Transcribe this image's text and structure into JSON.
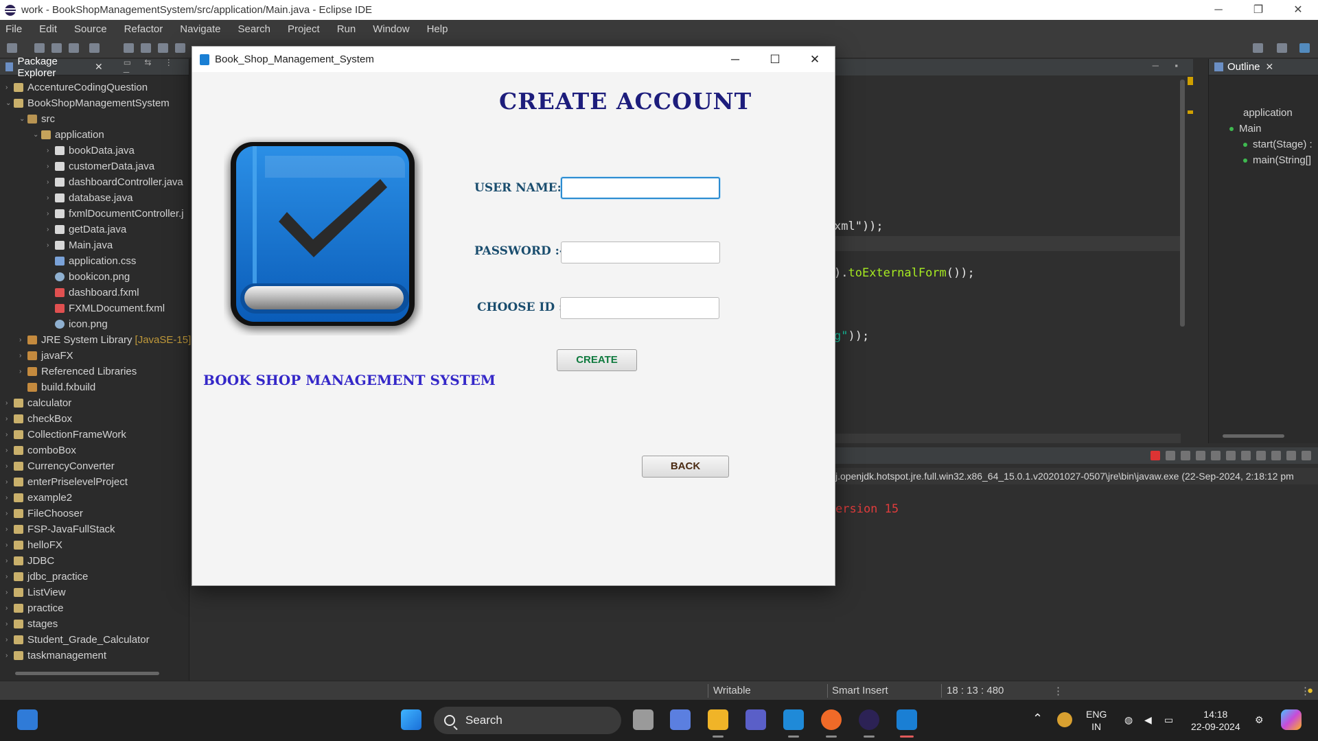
{
  "window": {
    "title": "work - BookShopManagementSystem/src/application/Main.java - Eclipse IDE",
    "controls": [
      "─",
      "❐",
      "✕"
    ]
  },
  "menu": [
    "File",
    "Edit",
    "Source",
    "Refactor",
    "Navigate",
    "Search",
    "Project",
    "Run",
    "Window",
    "Help"
  ],
  "package_explorer": {
    "tab_label": "Package Explorer",
    "close": "✕",
    "items": [
      {
        "label": "AccentureCodingQuestion",
        "icon": "project-icon",
        "chev": "›",
        "indent": 0
      },
      {
        "label": "BookShopManagementSystem",
        "icon": "project-icon",
        "chev": "⌄",
        "indent": 0
      },
      {
        "label": "src",
        "icon": "source-folder-icon",
        "chev": "⌄",
        "indent": 1
      },
      {
        "label": "application",
        "icon": "package-icon",
        "chev": "⌄",
        "indent": 2
      },
      {
        "label": "bookData.java",
        "icon": "java-file-icon",
        "chev": "›",
        "indent": 3
      },
      {
        "label": "customerData.java",
        "icon": "java-file-icon",
        "chev": "›",
        "indent": 3
      },
      {
        "label": "dashboardController.java",
        "icon": "java-file-icon",
        "chev": "›",
        "indent": 3
      },
      {
        "label": "database.java",
        "icon": "java-file-icon",
        "chev": "›",
        "indent": 3
      },
      {
        "label": "fxmlDocumentController.j",
        "icon": "java-file-icon",
        "chev": "›",
        "indent": 3
      },
      {
        "label": "getData.java",
        "icon": "java-file-icon",
        "chev": "›",
        "indent": 3
      },
      {
        "label": "Main.java",
        "icon": "java-file-icon",
        "chev": "›",
        "indent": 3
      },
      {
        "label": "application.css",
        "icon": "css-file-icon",
        "chev": "",
        "indent": 3
      },
      {
        "label": "bookicon.png",
        "icon": "image-file-icon",
        "chev": "",
        "indent": 3
      },
      {
        "label": "dashboard.fxml",
        "icon": "fxml-file-icon",
        "chev": "",
        "indent": 3
      },
      {
        "label": "FXMLDocument.fxml",
        "icon": "fxml-file-icon",
        "chev": "",
        "indent": 3
      },
      {
        "label": "icon.png",
        "icon": "image-file-icon",
        "chev": "",
        "indent": 3
      },
      {
        "label": "JRE System Library",
        "extra": "[JavaSE-15]",
        "icon": "library-icon",
        "chev": "›",
        "indent": 1
      },
      {
        "label": "javaFX",
        "icon": "library-icon",
        "chev": "›",
        "indent": 1
      },
      {
        "label": "Referenced Libraries",
        "icon": "library-icon",
        "chev": "›",
        "indent": 1
      },
      {
        "label": "build.fxbuild",
        "icon": "build-file-icon",
        "chev": "",
        "indent": 1
      },
      {
        "label": "calculator",
        "icon": "project-icon",
        "chev": "›",
        "indent": 0
      },
      {
        "label": "checkBox",
        "icon": "project-icon",
        "chev": "›",
        "indent": 0
      },
      {
        "label": "CollectionFrameWork",
        "icon": "project-icon",
        "chev": "›",
        "indent": 0
      },
      {
        "label": "comboBox",
        "icon": "project-icon",
        "chev": "›",
        "indent": 0
      },
      {
        "label": "CurrencyConverter",
        "icon": "project-icon",
        "chev": "›",
        "indent": 0
      },
      {
        "label": "enterPriselevelProject",
        "icon": "project-icon",
        "chev": "›",
        "indent": 0
      },
      {
        "label": "example2",
        "icon": "project-icon",
        "chev": "›",
        "indent": 0
      },
      {
        "label": "FileChooser",
        "icon": "project-icon",
        "chev": "›",
        "indent": 0
      },
      {
        "label": "FSP-JavaFullStack",
        "icon": "project-icon",
        "chev": "›",
        "indent": 0
      },
      {
        "label": "helloFX",
        "icon": "project-icon",
        "chev": "›",
        "indent": 0
      },
      {
        "label": "JDBC",
        "icon": "project-icon",
        "chev": "›",
        "indent": 0
      },
      {
        "label": "jdbc_practice",
        "icon": "project-icon",
        "chev": "›",
        "indent": 0
      },
      {
        "label": "ListView",
        "icon": "project-icon",
        "chev": "›",
        "indent": 0
      },
      {
        "label": "practice",
        "icon": "project-icon",
        "chev": "›",
        "indent": 0
      },
      {
        "label": "stages",
        "icon": "project-icon",
        "chev": "›",
        "indent": 0
      },
      {
        "label": "Student_Grade_Calculator",
        "icon": "project-icon",
        "chev": "›",
        "indent": 0
      },
      {
        "label": "taskmanagement",
        "icon": "project-icon",
        "chev": "›",
        "indent": 0
      }
    ]
  },
  "editor": {
    "visible_code": [
      {
        "text": "xml\"));",
        "color": "#e6e6e6"
      },
      {
        "text": ").toExternalForm());",
        "color": "#e6e6e6",
        "accent": "toExternalForm",
        "accent_color": "#a7ec21"
      },
      {
        "text": "g\"));",
        "color": "#e6e6e6",
        "accent": "g\"",
        "accent_color": "#17c6a3"
      }
    ]
  },
  "outline": {
    "tab_label": "Outline",
    "close": "✕",
    "items": [
      "application",
      "Main",
      "start(Stage) :",
      "main(String[]"
    ]
  },
  "console": {
    "path": "j.openjdk.hotspot.jre.full.win32.x86_64_15.0.1.v20201027-0507\\jre\\bin\\javaw.exe  (22-Sep-2024, 2:18:12 pm",
    "message": "ersion 15"
  },
  "status_bar": {
    "writable": "Writable",
    "insert_mode": "Smart Insert",
    "position": "18 : 13 : 480"
  },
  "taskbar": {
    "search_label": "Search",
    "lang_top": "ENG",
    "lang_bottom": "IN",
    "time": "14:18",
    "date": "22-09-2024"
  },
  "dialog": {
    "title": "Book_Shop_Management_System",
    "controls": [
      "─",
      "☐",
      "✕"
    ],
    "heading": "CREATE ACCOUNT",
    "subtitle": "BOOK SHOP MANAGEMENT SYSTEM",
    "username_label": "USER NAME:-",
    "username_value": "",
    "password_label": "PASSWORD :-",
    "password_value": "",
    "chooseid_label": "CHOOSE ID :-",
    "chooseid_value": "",
    "create_label": "CREATE",
    "back_label": "BACK"
  },
  "colors": {
    "heading": "#1d1d7c",
    "subtitle": "#3528c8",
    "field_label": "#1a4d6e",
    "create_text": "#0f7a3e",
    "back_text": "#4a2a12"
  }
}
